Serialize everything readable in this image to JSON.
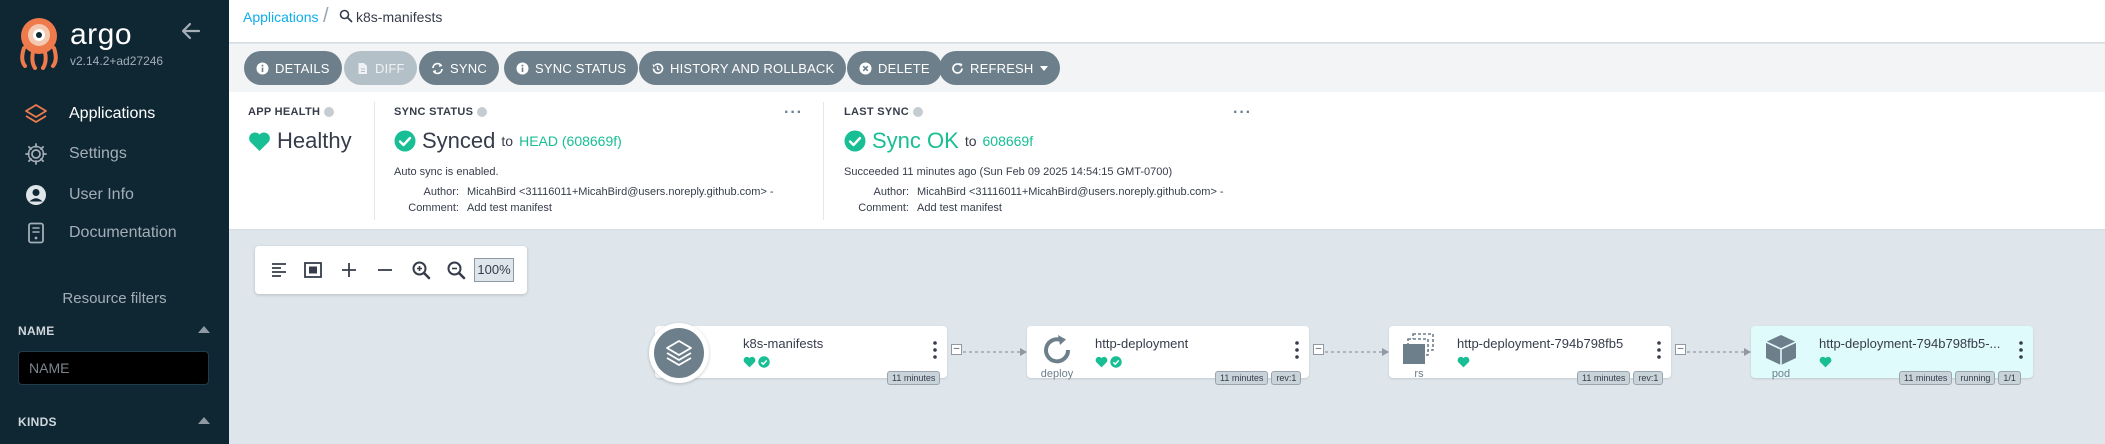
{
  "sidebar": {
    "brand": "argo",
    "version": "v2.14.2+ad27246",
    "nav": [
      {
        "label": "Applications",
        "icon": "layers-icon",
        "active": true
      },
      {
        "label": "Settings",
        "icon": "gear-icon",
        "active": false
      },
      {
        "label": "User Info",
        "icon": "user-icon",
        "active": false
      },
      {
        "label": "Documentation",
        "icon": "book-icon",
        "active": false
      }
    ],
    "resource_filters_title": "Resource filters",
    "name_filter_label": "NAME",
    "name_filter_placeholder": "NAME",
    "kinds_label": "KINDS"
  },
  "breadcrumb": {
    "root": "Applications",
    "separator": "/",
    "current": "k8s-manifests"
  },
  "actions": [
    {
      "label": "DETAILS",
      "icon": "info-icon",
      "disabled": false
    },
    {
      "label": "DIFF",
      "icon": "file-icon",
      "disabled": true
    },
    {
      "label": "SYNC",
      "icon": "sync-icon",
      "disabled": false
    },
    {
      "label": "SYNC STATUS",
      "icon": "info-icon",
      "disabled": false
    },
    {
      "label": "HISTORY AND ROLLBACK",
      "icon": "history-icon",
      "disabled": false
    },
    {
      "label": "DELETE",
      "icon": "delete-icon",
      "disabled": false
    },
    {
      "label": "REFRESH",
      "icon": "refresh-icon",
      "disabled": false
    }
  ],
  "status": {
    "app_health": {
      "title": "APP HEALTH",
      "value": "Healthy"
    },
    "sync_status": {
      "title": "SYNC STATUS",
      "value": "Synced",
      "to": "to",
      "revision": "HEAD (608669f)",
      "auto_sync": "Auto sync is enabled.",
      "author_label": "Author:",
      "author": "MicahBird <31116011+MicahBird@users.noreply.github.com> -",
      "comment_label": "Comment:",
      "comment": "Add test manifest"
    },
    "last_sync": {
      "title": "LAST SYNC",
      "value": "Sync OK",
      "to": "to",
      "revision": "608669f",
      "succeeded": "Succeeded 11 minutes ago (Sun Feb 09 2025 14:54:15 GMT-0700)",
      "author_label": "Author:",
      "author": "MicahBird <31116011+MicahBird@users.noreply.github.com> -",
      "comment_label": "Comment:",
      "comment": "Add test manifest"
    }
  },
  "zoom": {
    "level": "100%"
  },
  "graph": {
    "nodes": [
      {
        "name": "k8s-manifests",
        "kind": "",
        "badges": [
          "11 minutes"
        ],
        "health": [
          "heart",
          "check"
        ]
      },
      {
        "name": "http-deployment",
        "kind": "deploy",
        "badges": [
          "11 minutes",
          "rev:1"
        ],
        "health": [
          "heart",
          "check"
        ]
      },
      {
        "name": "http-deployment-794b798fb5",
        "kind": "rs",
        "badges": [
          "11 minutes",
          "rev:1"
        ],
        "health": [
          "heart"
        ]
      },
      {
        "name": "http-deployment-794b798fb5-...",
        "kind": "pod",
        "badges": [
          "11 minutes",
          "running",
          "1/1"
        ],
        "health": [
          "heart"
        ]
      }
    ]
  },
  "colors": {
    "sidebar_bg": "#0f2733",
    "accent_link": "#0dadea",
    "healthy_green": "#18be94",
    "button_gray": "#6d7f8b",
    "canvas_bg": "#dee6eb",
    "logo_orange": "#ef7b4d"
  }
}
